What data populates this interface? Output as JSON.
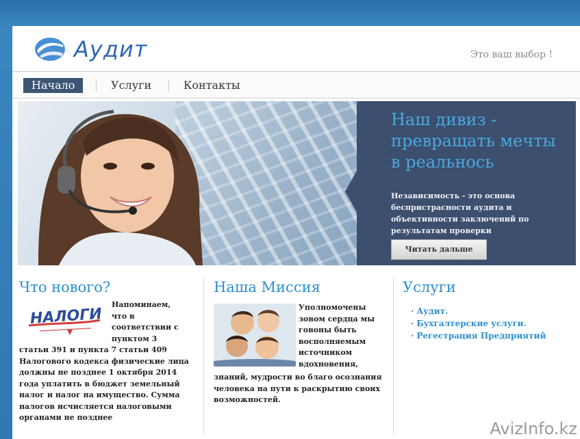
{
  "header": {
    "logo_text": "Аудит",
    "tagline": "Это ваш выбор !"
  },
  "nav": {
    "items": [
      {
        "label": "Начало",
        "active": true
      },
      {
        "label": "Услуги",
        "active": false
      },
      {
        "label": "Контакты",
        "active": false
      }
    ]
  },
  "hero": {
    "heading": "Наш дивиз - превращать мечты в реальнось",
    "text": "Независимость - это основа беспристрасности аудита и объективности заключений по результатам проверки",
    "button_label": "Читать дальше"
  },
  "news": {
    "title": "Что нового?",
    "logo_text": "НАЛОГИ",
    "text_right": "Напоминаем, что в соответствии с пунктом 3",
    "text_full": "статьи 391 и пункта 7 статьи 409 Налогового кодекса физические лица должны не позднее 1 октября 2014 года уплатить в бюджет земельный налог и налог на имущество. Сумма налогов исчисляется налоговыми органами не позднее"
  },
  "mission": {
    "title": "Наша Миссия",
    "text_right": "Уполномочены зовом сердца мы говоны быть восполняемым источником вдохновения,",
    "text_full": "знаний, мудрости во благо осознания человека на пути к раскрытию своих возможностей."
  },
  "services": {
    "title": "Услуги",
    "items": [
      "· Аудит.",
      "· Бухгалтерские услуги.",
      "· Регестрация Предприятий"
    ]
  },
  "watermark": "AvizInfo.kz",
  "colors": {
    "accent": "#2d8fcf",
    "nav_active": "#3b5675",
    "hero_panel": "#3c4f6e",
    "hero_heading": "#4aa8de"
  }
}
